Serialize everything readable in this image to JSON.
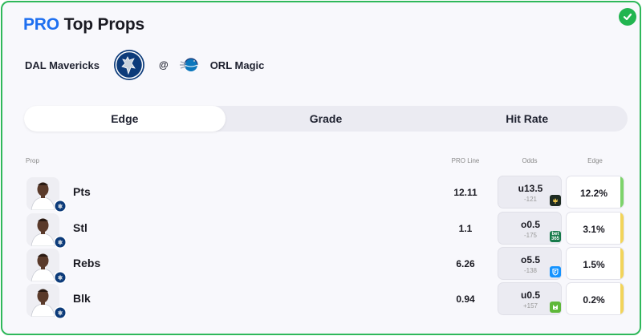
{
  "header": {
    "pro": "PRO",
    "title": "Top Props"
  },
  "matchup": {
    "away": "DAL Mavericks",
    "separator": "@",
    "home": "ORL Magic"
  },
  "tabs": [
    {
      "label": "Edge",
      "active": true
    },
    {
      "label": "Grade",
      "active": false
    },
    {
      "label": "Hit Rate",
      "active": false
    }
  ],
  "columns": {
    "prop": "Prop",
    "pro_line": "PRO Line",
    "odds": "Odds",
    "edge": "Edge"
  },
  "rows": [
    {
      "stat": "Pts",
      "pro_line": "12.11",
      "odds_line": "u13.5",
      "odds_price": "-121",
      "book": "draftkings-crown-icon",
      "edge": "12.2%",
      "edge_color": "#7dd36b"
    },
    {
      "stat": "Stl",
      "pro_line": "1.1",
      "odds_line": "o0.5",
      "odds_price": "-175",
      "book": "bet365-icon",
      "book_text": "bet 365",
      "edge": "3.1%",
      "edge_color": "#f2d45a"
    },
    {
      "stat": "Rebs",
      "pro_line": "6.26",
      "odds_line": "o5.5",
      "odds_price": "-138",
      "book": "fanduel-shield-icon",
      "edge": "1.5%",
      "edge_color": "#f2d45a"
    },
    {
      "stat": "Blk",
      "pro_line": "0.94",
      "odds_line": "u0.5",
      "odds_price": "+157",
      "book": "draftkings-icon",
      "edge": "0.2%",
      "edge_color": "#f2d45a"
    }
  ],
  "colors": {
    "accent": "#1e6ff0",
    "border": "#2fb85a",
    "check": "#22b550"
  }
}
